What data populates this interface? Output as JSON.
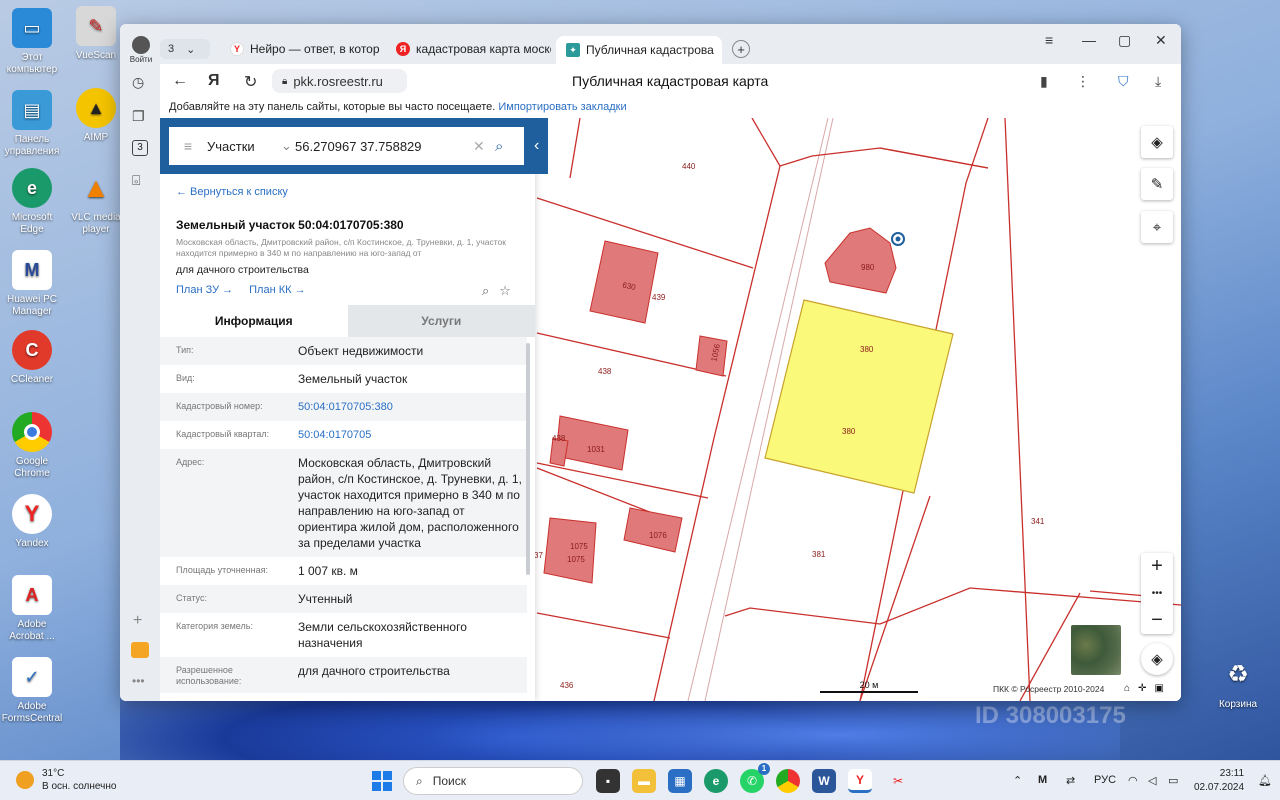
{
  "desktop": {
    "icons": [
      {
        "label": "Этот компьютер"
      },
      {
        "label": "VueScan"
      },
      {
        "label": "Панель управления"
      },
      {
        "label": "AIMP"
      },
      {
        "label": "Microsoft Edge"
      },
      {
        "label": "VLC media player"
      },
      {
        "label": "Huawei PC Manager"
      },
      {
        "label": "CCleaner"
      },
      {
        "label": "Google Chrome"
      },
      {
        "label": "Yandex"
      },
      {
        "label": "Adobe Acrobat ..."
      },
      {
        "label": "Adobe FormsCentral"
      }
    ],
    "recycle_bin": "Корзина",
    "watermark": "ID 308003175"
  },
  "browser": {
    "profile_label": "Войти",
    "tab_count": "3",
    "tabs": [
      {
        "label": "Нейро — ответ, в которо"
      },
      {
        "label": "кадастровая карта моско"
      },
      {
        "label": "Публичная кадастрова"
      }
    ],
    "address": "pkk.rosreestr.ru",
    "page_title": "Публичная кадастровая карта",
    "bookmarks_text": "Добавляйте на эту панель сайты, которые вы часто посещаете.",
    "bookmarks_link": "Импортировать закладки",
    "sidebar_badge": "3"
  },
  "search": {
    "mode": "Участки",
    "query": "56.270967 37.758829"
  },
  "parcel": {
    "back_link": "← Вернуться к списку",
    "title": "Земельный участок 50:04:0170705:380",
    "address_small": "Московская область, Дмитровский район, с/п Костинское, д. Труневки, д. 1, участок находится примерно в 340 м по направлению на юго-запад от",
    "purpose": "для дачного строительства",
    "plan_zu": "План ЗУ →",
    "plan_kk": "План КК →",
    "tab_info": "Информация",
    "tab_services": "Услуги",
    "properties": [
      {
        "key": "Тип:",
        "value": "Объект недвижимости",
        "link": false
      },
      {
        "key": "Вид:",
        "value": "Земельный участок",
        "link": false
      },
      {
        "key": "Кадастровый номер:",
        "value": "50:04:0170705:380",
        "link": true
      },
      {
        "key": "Кадастровый квартал:",
        "value": "50:04:0170705",
        "link": true
      },
      {
        "key": "Адрес:",
        "value": "Московская область, Дмитровский район, с/п Костинское, д. Труневки, д. 1, участок находится примерно в 340 м по направлению на юго-запад от ориентира жилой дом, расположенного за пределами участка",
        "link": false
      },
      {
        "key": "Площадь уточненная:",
        "value": "1 007 кв. м",
        "link": false
      },
      {
        "key": "Статус:",
        "value": "Учтенный",
        "link": false
      },
      {
        "key": "Категория земель:",
        "value": "Земли сельскохозяйственного назначения",
        "link": false
      },
      {
        "key": "Разрешенное использование:",
        "value": "для дачного строительства",
        "link": false
      }
    ]
  },
  "map": {
    "labels": [
      "440",
      "630",
      "439",
      "1056",
      "438",
      "438",
      "1031",
      "1075",
      "1075",
      "1076",
      "37",
      "980",
      "380",
      "380",
      "381",
      "341",
      "436"
    ],
    "scale": "20 м",
    "copyright": "ПКК © Росреестр 2010-2024"
  },
  "taskbar": {
    "temp": "31°C",
    "weather": "В осн. солнечно",
    "search": "Поиск",
    "lang": "РУС",
    "time": "23:11",
    "date": "02.07.2024",
    "whatsapp_badge": "1"
  },
  "colors": {
    "accent": "#1f5f9e",
    "parcel_fill": "#fbf97a",
    "building_fill": "#e07a7a",
    "boundary": "#c9302c"
  }
}
